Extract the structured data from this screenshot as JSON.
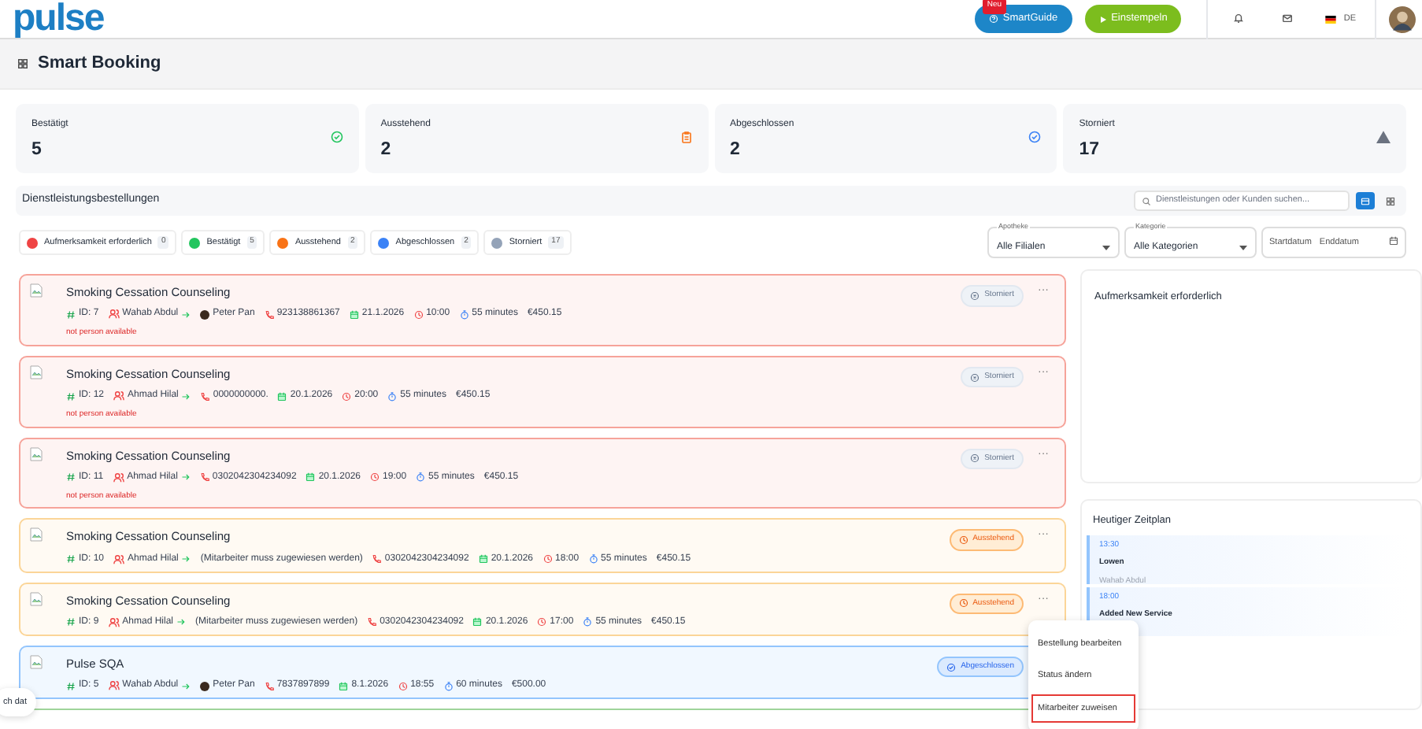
{
  "header": {
    "logo": "pulse",
    "smartguide": {
      "label": "SmartGuide",
      "badge": "Neu"
    },
    "clock_in": "Einstempeln",
    "language": "DE"
  },
  "page_title": "Smart Booking",
  "stats": [
    {
      "label": "Bestätigt",
      "value": "5",
      "kind": "confirmed"
    },
    {
      "label": "Ausstehend",
      "value": "2",
      "kind": "pending"
    },
    {
      "label": "Abgeschlossen",
      "value": "2",
      "kind": "completed"
    },
    {
      "label": "Storniert",
      "value": "17",
      "kind": "cancelled"
    }
  ],
  "orders_section": {
    "title": "Dienstleistungsbestellungen",
    "search": {
      "placeholder": "Dienstleistungen oder Kunden suchen..."
    },
    "view_toggles": [
      {
        "kind": "list",
        "selected": true
      },
      {
        "kind": "grid",
        "selected": false
      }
    ],
    "legend": [
      {
        "label": "Aufmerksamkeit erforderlich",
        "count": "0",
        "color": "#ef4444"
      },
      {
        "label": "Bestätigt",
        "count": "5",
        "color": "#22c55e"
      },
      {
        "label": "Ausstehend",
        "count": "2",
        "color": "#f97316"
      },
      {
        "label": "Abgeschlossen",
        "count": "2",
        "color": "#3b82f6"
      },
      {
        "label": "Storniert",
        "count": "17",
        "color": "#94a3b8"
      }
    ],
    "filters": [
      {
        "label": "Apotheke",
        "value": "Alle Filialen"
      },
      {
        "label": "Kategorie",
        "value": "Alle Kategorien"
      }
    ],
    "date_range": {
      "start_placeholder": "Startdatum",
      "end_placeholder": "Enddatum"
    }
  },
  "orders": [
    {
      "title": "Smoking Cessation Counseling",
      "id": "ID: 7",
      "customer": "Wahab Abdul",
      "staff": "Peter Pan",
      "phone": "923138861367",
      "date": "21.1.2026",
      "time": "10:00",
      "duration": "55 minutes",
      "price": "€450.15",
      "warning": "not person available",
      "status": {
        "label": "Storniert",
        "kind": "cancelled"
      },
      "more": "···"
    },
    {
      "title": "Smoking Cessation Counseling",
      "id": "ID: 12",
      "customer": "Ahmad Hilal",
      "phone": "0000000000.",
      "date": "20.1.2026",
      "time": "20:00",
      "duration": "55 minutes",
      "price": "€450.15",
      "warning": "not person available",
      "status": {
        "label": "Storniert",
        "kind": "cancelled"
      },
      "more": "···"
    },
    {
      "title": "Smoking Cessation Counseling",
      "id": "ID: 11",
      "customer": "Ahmad Hilal",
      "phone": "0302042304234092",
      "date": "20.1.2026",
      "time": "19:00",
      "duration": "55 minutes",
      "price": "€450.15",
      "warning": "not person available",
      "status": {
        "label": "Storniert",
        "kind": "cancelled"
      },
      "more": "···"
    },
    {
      "title": "Smoking Cessation Counseling",
      "id": "ID: 10",
      "customer": "Ahmad Hilal",
      "staff_note": "(Mitarbeiter muss zugewiesen werden)",
      "phone": "0302042304234092",
      "date": "20.1.2026",
      "time": "18:00",
      "duration": "55 minutes",
      "price": "€450.15",
      "status": {
        "label": "Ausstehend",
        "kind": "pending"
      },
      "more": "···"
    },
    {
      "title": "Smoking Cessation Counseling",
      "id": "ID: 9",
      "customer": "Ahmad Hilal",
      "staff_note": "(Mitarbeiter muss zugewiesen werden)",
      "phone": "0302042304234092",
      "date": "20.1.2026",
      "time": "17:00",
      "duration": "55 minutes",
      "price": "€450.15",
      "status": {
        "label": "Ausstehend",
        "kind": "pending"
      },
      "more": "···"
    },
    {
      "title": "Pulse SQA",
      "id": "ID: 5",
      "customer": "Wahab Abdul",
      "staff": "Peter Pan",
      "phone": "7837897899",
      "date": "8.1.2026",
      "time": "18:55",
      "duration": "60 minutes",
      "price": "€500.00",
      "status": {
        "label": "Abgeschlossen",
        "kind": "completed"
      }
    }
  ],
  "attention_panel": {
    "title": "Aufmerksamkeit erforderlich"
  },
  "schedule": {
    "title": "Heutiger Zeitplan",
    "items": [
      {
        "time": "13:30",
        "title": "Lowen",
        "subtitle": "Wahab Abdul"
      },
      {
        "time": "18:00",
        "title": "Added New Service"
      }
    ]
  },
  "context_menu": {
    "items": [
      {
        "label": "Bestellung bearbeiten",
        "selected": false
      },
      {
        "label": "Status ändern",
        "selected": false
      },
      {
        "label": "Mitarbeiter zuweisen",
        "selected": true
      }
    ]
  },
  "chat_bubble": {
    "text": "ch dat"
  }
}
